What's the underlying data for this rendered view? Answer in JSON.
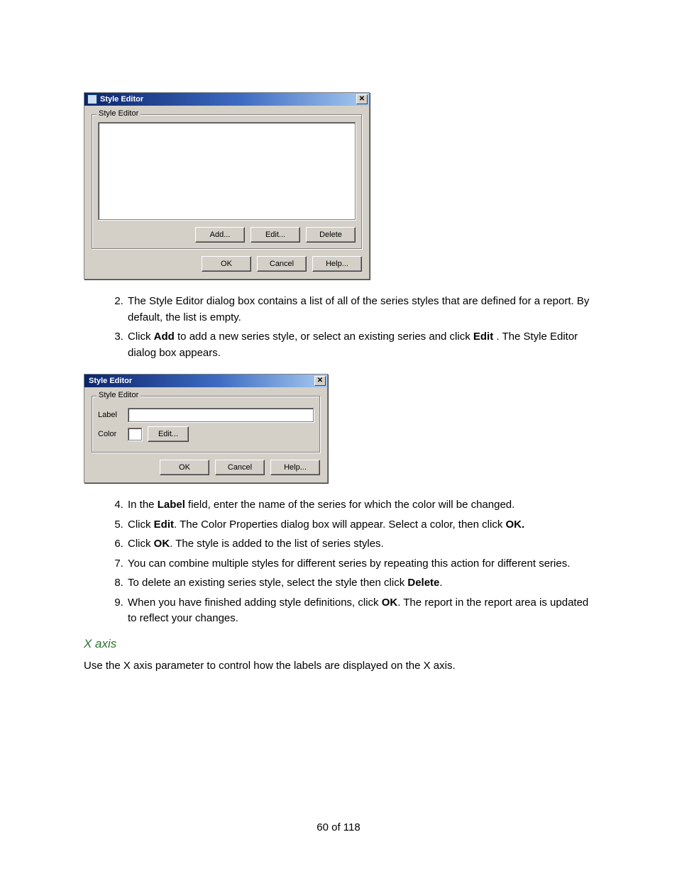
{
  "dialog1": {
    "title": "Style Editor",
    "group_legend": "Style Editor",
    "buttons_row1": {
      "add": "Add...",
      "edit": "Edit...",
      "delete": "Delete"
    },
    "buttons_row2": {
      "ok": "OK",
      "cancel": "Cancel",
      "help": "Help..."
    }
  },
  "dialog2": {
    "title": "Style Editor",
    "group_legend": "Style Editor",
    "label_lbl": "Label",
    "color_lbl": "Color",
    "edit_btn": "Edit...",
    "buttons": {
      "ok": "OK",
      "cancel": "Cancel",
      "help": "Help..."
    }
  },
  "steps": {
    "s2": {
      "pre": "The Style Editor dialog box contains a list of all of the series styles that are defined for a report. By default, the list is empty."
    },
    "s3": {
      "pre": "Click ",
      "b1": "Add",
      "mid": " to add a new series style, or select an existing series and click ",
      "b2": "Edit",
      "post": " . The Style Editor dialog box appears."
    },
    "s4": {
      "pre": "In the ",
      "b1": "Label",
      "post": " field, enter the name of the series for which the color will be changed."
    },
    "s5": {
      "pre": "Click ",
      "b1": "Edit",
      "mid": ". The Color Properties dialog box will appear. Select a color, then click ",
      "b2": "OK."
    },
    "s6": {
      "pre": "Click ",
      "b1": "OK",
      "post": ". The style is added to the list of series styles."
    },
    "s7": {
      "pre": "You can combine multiple styles for different series by repeating this action for different series."
    },
    "s8": {
      "pre": "To delete an existing series style, select the style then click ",
      "b1": "Delete",
      "post": "."
    },
    "s9": {
      "pre": "When you have finished adding style definitions, click ",
      "b1": "OK",
      "post": ". The report in the report area is updated to reflect your changes."
    }
  },
  "section": {
    "heading": "X axis",
    "para": "Use the X axis parameter to control how the labels are displayed on the X axis."
  },
  "page_number": "60 of 118"
}
